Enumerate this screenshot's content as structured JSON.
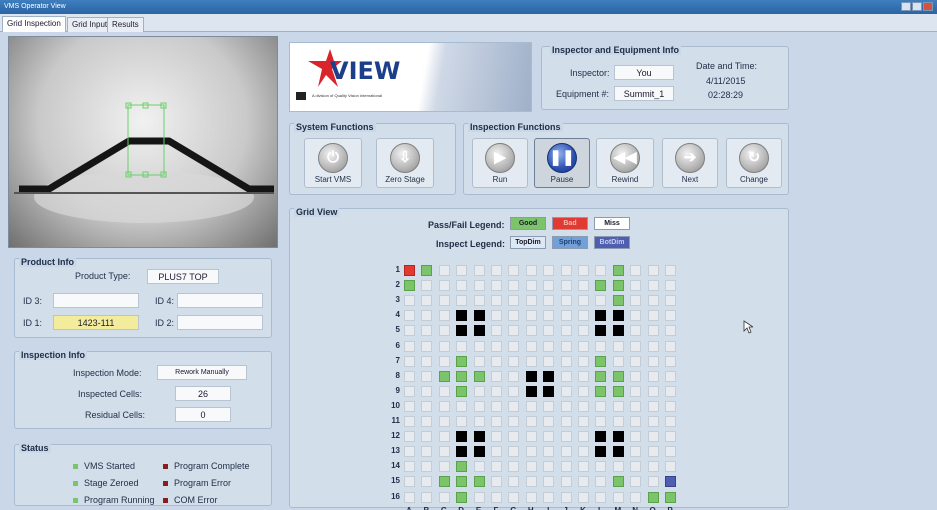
{
  "window": {
    "title": "VMS Operator View"
  },
  "tabs": [
    "Grid Inspection",
    "Grid Input",
    "Results"
  ],
  "logo": {
    "text": "VIEW",
    "tagline": "A division of Quality Vision International"
  },
  "inspector_info": {
    "title": "Inspector and Equipment Info",
    "inspector_label": "Inspector:",
    "inspector_value": "You",
    "equipment_label": "Equipment #:",
    "equipment_value": "Summit_1",
    "datetime_label": "Date and Time:",
    "date": "4/11/2015",
    "time": "02:28:29"
  },
  "system_functions": {
    "title": "System Functions",
    "buttons": [
      {
        "label": "Start VMS",
        "icon": "power-icon"
      },
      {
        "label": "Zero Stage",
        "icon": "download-arrow-icon"
      }
    ]
  },
  "inspection_functions": {
    "title": "Inspection Functions",
    "buttons": [
      {
        "label": "Run",
        "icon": "play-icon"
      },
      {
        "label": "Pause",
        "icon": "pause-icon",
        "pressed": true
      },
      {
        "label": "Rewind",
        "icon": "rewind-icon"
      },
      {
        "label": "Next",
        "icon": "next-arrow-icon"
      },
      {
        "label": "Change",
        "icon": "refresh-icon"
      }
    ]
  },
  "product_info": {
    "title": "Product Info",
    "product_type_label": "Product Type:",
    "product_type_value": "PLUS7 TOP",
    "id3_label": "ID 3:",
    "id3_value": "",
    "id4_label": "ID 4:",
    "id4_value": "",
    "id1_label": "ID 1:",
    "id1_value": "1423-111",
    "id2_label": "ID 2:",
    "id2_value": ""
  },
  "inspection_info": {
    "title": "Inspection Info",
    "mode_label": "Inspection Mode:",
    "mode_value": "Rework Manually",
    "inspected_label": "Inspected Cells:",
    "inspected_value": "26",
    "residual_label": "Residual Cells:",
    "residual_value": "0"
  },
  "status": {
    "title": "Status",
    "items": [
      {
        "label": "VMS Started",
        "color": "#7cc46a"
      },
      {
        "label": "Program Complete",
        "color": "#8b1d1d"
      },
      {
        "label": "Stage Zeroed",
        "color": "#7cc46a"
      },
      {
        "label": "Program Error",
        "color": "#8b1d1d"
      },
      {
        "label": "Program Running",
        "color": "#7cc46a"
      },
      {
        "label": "COM Error",
        "color": "#8b1d1d"
      }
    ]
  },
  "grid_view": {
    "title": "Grid View",
    "pass_fail_label": "Pass/Fail Legend:",
    "pass_fail": [
      {
        "label": "Good",
        "color": "#7cc46a",
        "text_color": "#1f2d45"
      },
      {
        "label": "Bad",
        "color": "#e03a32",
        "text_color": "#f2b8b0"
      },
      {
        "label": "Miss",
        "color": "#ffffff",
        "text_color": "#1f2d45"
      }
    ],
    "inspect_label": "Inspect Legend:",
    "inspect": [
      {
        "label": "TopDim",
        "color": "#dce8f2",
        "text_color": "#1f2d45"
      },
      {
        "label": "Spring",
        "color": "#72a0d8",
        "text_color": "#1f3f7a"
      },
      {
        "label": "BotDim",
        "color": "#4f5eb0",
        "text_color": "#c7cdf0"
      }
    ],
    "rows": [
      "1",
      "2",
      "3",
      "4",
      "5",
      "6",
      "7",
      "8",
      "9",
      "10",
      "11",
      "12",
      "13",
      "14",
      "15",
      "16"
    ],
    "cols": [
      "A",
      "B",
      "C",
      "D",
      "E",
      "F",
      "G",
      "H",
      "I",
      "J",
      "K",
      "L",
      "M",
      "N",
      "O",
      "P"
    ],
    "cells": {
      "good": [
        "1B",
        "1M",
        "2A",
        "2L",
        "2M",
        "3M",
        "7D",
        "7L",
        "8C",
        "8D",
        "8E",
        "8L",
        "8M",
        "9D",
        "9L",
        "9M",
        "14D",
        "15C",
        "15D",
        "15E",
        "15M",
        "16D",
        "16O",
        "16P"
      ],
      "bad": [
        "1A"
      ],
      "botdim": [
        "15P"
      ],
      "fiducial": [
        "4D",
        "4E",
        "5D",
        "5E",
        "4L",
        "4M",
        "5L",
        "5M",
        "8H",
        "8I",
        "9H",
        "9I",
        "12D",
        "12E",
        "13D",
        "13E",
        "12L",
        "12M",
        "13L",
        "13M"
      ]
    }
  }
}
